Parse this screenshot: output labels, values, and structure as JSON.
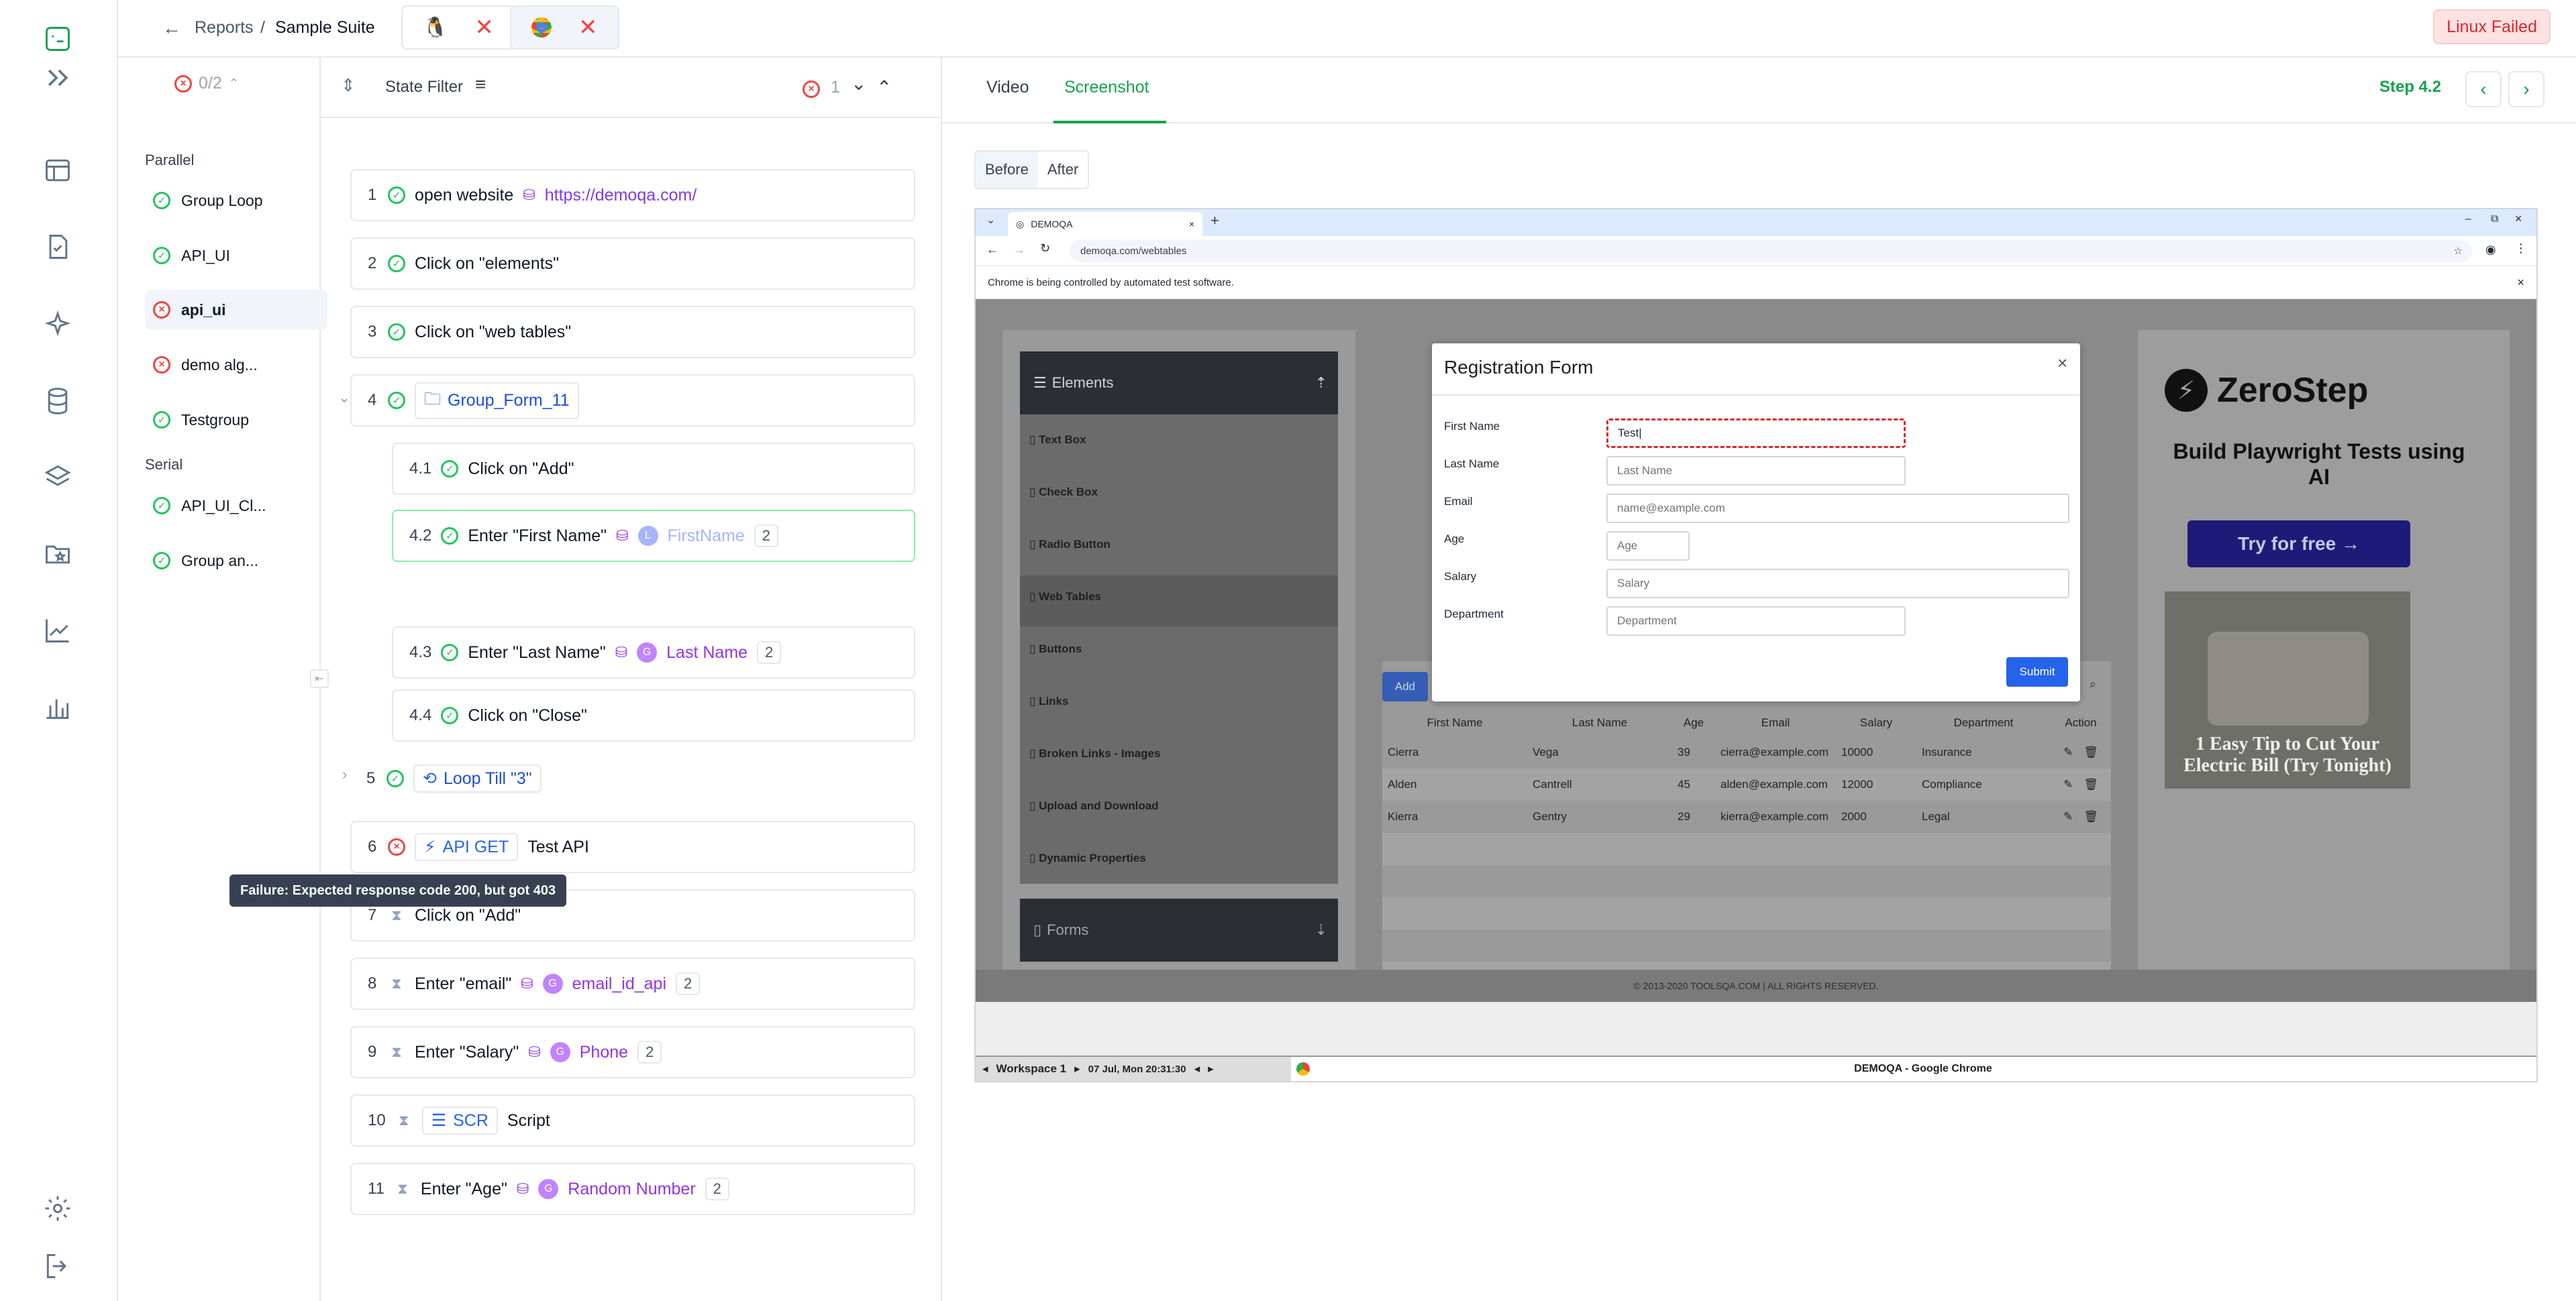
{
  "header": {
    "breadcrumb_root": "Reports",
    "breadcrumb_sep": "/",
    "breadcrumb_current": "Sample Suite",
    "status_badge": "Linux Failed",
    "colors": {
      "error": "#ef4444",
      "success": "#22c55e",
      "accent": "#16a34a",
      "badge_bg": "#fee2e2"
    }
  },
  "suites": {
    "counter": "0/2",
    "group_parallel": "Parallel",
    "group_serial": "Serial",
    "parallel_items": [
      {
        "label": "Group Loop",
        "status": "ok"
      },
      {
        "label": "API_UI",
        "status": "ok"
      },
      {
        "label": "api_ui",
        "status": "err"
      },
      {
        "label": "demo alg...",
        "status": "err"
      },
      {
        "label": "Testgroup",
        "status": "ok"
      }
    ],
    "serial_items": [
      {
        "label": "API_UI_Cl...",
        "status": "ok"
      },
      {
        "label": "Group an...",
        "status": "ok"
      }
    ]
  },
  "steps": {
    "filter_label": "State Filter",
    "error_count": "1",
    "tooltip": "Failure: Expected response code 200, but got 403",
    "items": {
      "s1": {
        "num": "1",
        "action": "open website",
        "url": "https://demoqa.com/"
      },
      "s2": {
        "num": "2",
        "action": "Click on \"elements\""
      },
      "s3": {
        "num": "3",
        "action": "Click on \"web tables\""
      },
      "s4": {
        "num": "4",
        "group": "Group_Form_11"
      },
      "s41": {
        "num": "4.1",
        "action": "Click on \"Add\""
      },
      "s42": {
        "num": "4.2",
        "action": "Enter \"First Name\"",
        "badge": "L",
        "var": "FirstName",
        "count": "2"
      },
      "s43": {
        "num": "4.3",
        "action": "Enter \"Last Name\"",
        "badge": "G",
        "var": "Last Name",
        "count": "2"
      },
      "s44": {
        "num": "4.4",
        "action": "Click on \"Close\""
      },
      "s5": {
        "num": "5",
        "loop": "Loop Till \"3\""
      },
      "s6": {
        "num": "6",
        "method": "API GET",
        "action": "Test API"
      },
      "s7": {
        "num": "7",
        "action": "Click on \"Add\""
      },
      "s8": {
        "num": "8",
        "action": "Enter \"email\"",
        "badge": "G",
        "var": "email_id_api",
        "count": "2"
      },
      "s9": {
        "num": "9",
        "action": "Enter \"Salary\"",
        "badge": "G",
        "var": "Phone",
        "count": "2"
      },
      "s10": {
        "num": "10",
        "tag": "SCR",
        "action": "Script"
      },
      "s11": {
        "num": "11",
        "action": "Enter \"Age\"",
        "badge": "G",
        "var": "Random Number",
        "count": "2"
      }
    }
  },
  "view": {
    "tab_video": "Video",
    "tab_screenshot": "Screenshot",
    "step_label": "Step 4.2",
    "before": "Before",
    "after": "After"
  },
  "browser": {
    "tab_title": "DEMOQA",
    "address": "demoqa.com/webtables",
    "automation_notice": "Chrome is being controlled by automated test software.",
    "sidebar": {
      "elements": "Elements",
      "items": [
        "Text Box",
        "Check Box",
        "Radio Button",
        "Web Tables",
        "Buttons",
        "Links",
        "Broken Links - Images",
        "Upload and Download",
        "Dynamic Properties"
      ],
      "forms": "Forms"
    },
    "modal": {
      "title": "Registration Form",
      "close": "×",
      "labels": {
        "first": "First Name",
        "last": "Last Name",
        "email": "Email",
        "age": "Age",
        "salary": "Salary",
        "dept": "Department"
      },
      "first_value": "Test",
      "placeholders": {
        "last": "Last Name",
        "email": "name@example.com",
        "age": "Age",
        "salary": "Salary",
        "dept": "Department"
      },
      "submit": "Submit"
    },
    "add_button": "Add",
    "table": {
      "headers": [
        "First Name",
        "Last Name",
        "Age",
        "Email",
        "Salary",
        "Department",
        "Action"
      ],
      "rows": [
        [
          "Cierra",
          "Vega",
          "39",
          "cierra@example.com",
          "10000",
          "Insurance"
        ],
        [
          "Alden",
          "Cantrell",
          "45",
          "alden@example.com",
          "12000",
          "Compliance"
        ],
        [
          "Kierra",
          "Gentry",
          "29",
          "kierra@example.com",
          "2000",
          "Legal"
        ]
      ]
    },
    "ad": {
      "brand": "ZeroStep",
      "headline": "Build Playwright Tests using AI",
      "cta": "Try for free →",
      "caption": "1 Easy Tip to Cut Your Electric Bill (Try Tonight)"
    },
    "footer": "© 2013-2020 TOOLSQA.COM | ALL RIGHTS RESERVED.",
    "taskbar": {
      "workspace": "Workspace 1",
      "datetime": "07 Jul, Mon 20:31:30",
      "window_title": "DEMOQA - Google Chrome"
    }
  }
}
